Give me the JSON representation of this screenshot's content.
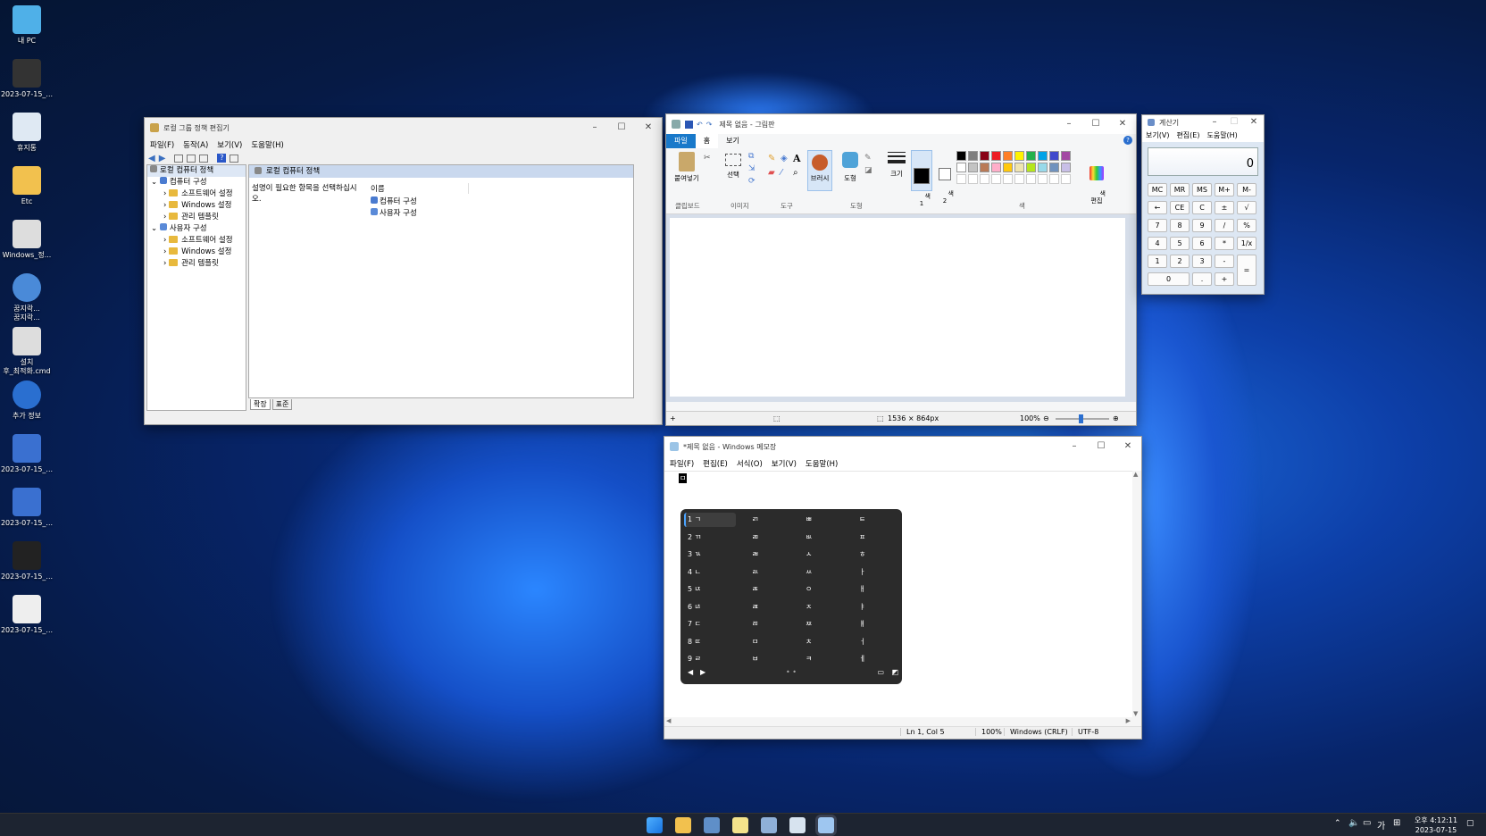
{
  "desktop": {
    "icons": [
      {
        "label": "내 PC"
      },
      {
        "label": "2023-07-15_..."
      },
      {
        "label": "휴지통"
      },
      {
        "label": "Etc"
      },
      {
        "label": "Windows_정..."
      },
      {
        "label": "꿈지락...\n꿈지락..."
      },
      {
        "label": "설치\n후_최적화.cmd"
      },
      {
        "label": "추가 정보"
      },
      {
        "label": "2023-07-15_..."
      },
      {
        "label": "2023-07-15_..."
      },
      {
        "label": "2023-07-15_..."
      },
      {
        "label": "2023-07-15_..."
      }
    ]
  },
  "gpedit": {
    "title": "로컬 그룹 정책 편집기",
    "menu": [
      "파일(F)",
      "동작(A)",
      "보기(V)",
      "도움말(H)"
    ],
    "tree": {
      "root": "로컬 컴퓨터 정책",
      "computer": "컴퓨터 구성",
      "computer_children": [
        "소프트웨어 설정",
        "Windows 설정",
        "관리 템플릿"
      ],
      "user": "사용자 구성",
      "user_children": [
        "소프트웨어 설정",
        "Windows 설정",
        "관리 템플릿"
      ]
    },
    "pane_header": "로컬 컴퓨터 정책",
    "description": "설명이 필요한 항목을 선택하십시오.",
    "column_name": "이름",
    "items": [
      "컴퓨터 구성",
      "사용자 구성"
    ],
    "tabs": [
      "확장",
      "표준"
    ]
  },
  "paint": {
    "title": "제목 없음 - 그림판",
    "tabs": [
      "파일",
      "홈",
      "보기"
    ],
    "groups": {
      "clipboard": "클립보드",
      "image": "이미지",
      "tools": "도구",
      "shapes": "도형",
      "colors": "색"
    },
    "buttons": {
      "paste": "붙여넣기",
      "select": "선택",
      "brush": "브러시",
      "shapes": "도형",
      "size": "크기",
      "color1": "색\n1",
      "color2": "색\n2",
      "edit_colors": "색\n편집"
    },
    "palette_top": [
      "#000000",
      "#7f7f7f",
      "#880015",
      "#ed1c24",
      "#ff7f27",
      "#fff200",
      "#22b14c",
      "#00a2e8",
      "#3f48cc",
      "#a349a4"
    ],
    "palette_mid": [
      "#ffffff",
      "#c3c3c3",
      "#b97a57",
      "#ffaec9",
      "#ffc90e",
      "#efe4b0",
      "#b5e61d",
      "#99d9ea",
      "#7092be",
      "#c8bfe7"
    ],
    "status": {
      "size": "1536 × 864px",
      "zoom": "100%"
    }
  },
  "calc": {
    "title": "계산기",
    "menu": [
      "보기(V)",
      "편집(E)",
      "도움말(H)"
    ],
    "display": "0",
    "buttons": [
      [
        "MC",
        "MR",
        "MS",
        "M+",
        "M-"
      ],
      [
        "←",
        "CE",
        "C",
        "±",
        "√"
      ],
      [
        "7",
        "8",
        "9",
        "/",
        "%"
      ],
      [
        "4",
        "5",
        "6",
        "*",
        "1/x"
      ],
      [
        "1",
        "2",
        "3",
        "-",
        "="
      ],
      [
        "0",
        ".",
        "+"
      ]
    ]
  },
  "notepad": {
    "title": "*제목 없음 - Windows 메모장",
    "menu": [
      "파일(F)",
      "편집(E)",
      "서식(O)",
      "보기(V)",
      "도움말(H)"
    ],
    "composing": "ㅁ",
    "ime_columns": [
      [
        "1 ㄱ",
        "2 ㄲ",
        "3 ㄳ",
        "4 ㄴ",
        "5 ㄵ",
        "6 ㄶ",
        "7 ㄷ",
        "8 ㄸ",
        "9 ㄹ"
      ],
      [
        "ㄺ",
        "ㄻ",
        "ㄼ",
        "ㄽ",
        "ㄾ",
        "ㄿ",
        "ㅀ",
        "ㅁ",
        "ㅂ"
      ],
      [
        "ㅃ",
        "ㅄ",
        "ㅅ",
        "ㅆ",
        "ㅇ",
        "ㅈ",
        "ㅉ",
        "ㅊ",
        "ㅋ"
      ],
      [
        "ㅌ",
        "ㅍ",
        "ㅎ",
        "ㅏ",
        "ㅐ",
        "ㅑ",
        "ㅒ",
        "ㅓ",
        "ㅔ"
      ]
    ],
    "status": {
      "position": "Ln 1, Col 5",
      "zoom": "100%",
      "eol": "Windows (CRLF)",
      "encoding": "UTF-8"
    }
  },
  "taskbar": {
    "time": "오후 4:12:11",
    "date": "2023-07-15",
    "ime": "가"
  }
}
